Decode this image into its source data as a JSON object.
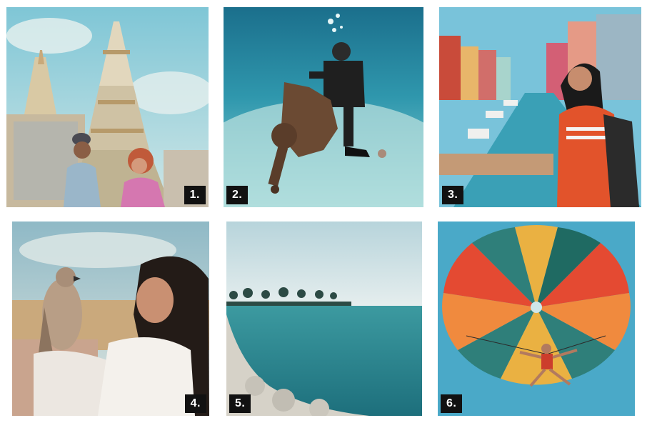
{
  "photos": [
    {
      "number": "1.",
      "subject": "temple-couple"
    },
    {
      "number": "2.",
      "subject": "diver-on-scooter"
    },
    {
      "number": "3.",
      "subject": "canal-girl"
    },
    {
      "number": "4.",
      "subject": "falcon-woman"
    },
    {
      "number": "5.",
      "subject": "coastline"
    },
    {
      "number": "6.",
      "subject": "parasail"
    }
  ]
}
